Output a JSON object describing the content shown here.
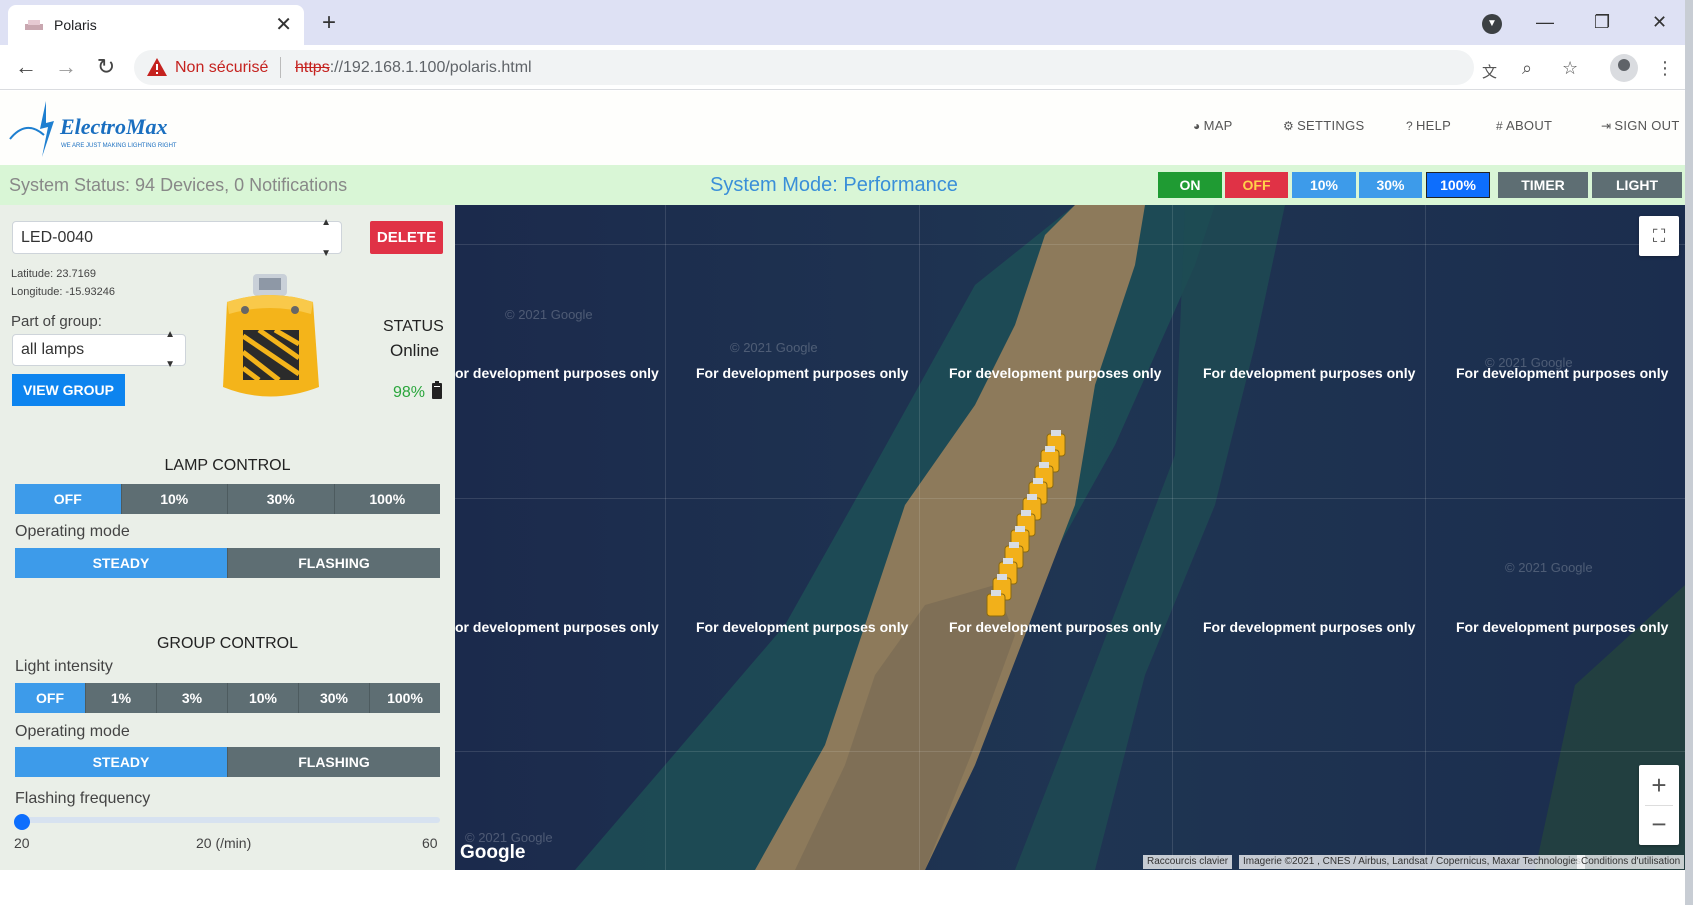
{
  "browser": {
    "tab_title": "Polaris",
    "not_secure": "Non sécurisé",
    "url_scheme": "https",
    "url_rest": "://192.168.1.100/polaris.html"
  },
  "header": {
    "logo_text": "ElectroMax",
    "logo_tagline": "WE ARE JUST MAKING LIGHTING RIGHT",
    "nav": {
      "map": "MAP",
      "settings": "SETTINGS",
      "help": "HELP",
      "about": "ABOUT",
      "sign_out": "SIGN OUT"
    }
  },
  "status_bar": {
    "system_status": "System Status: 94 Devices, 0 Notifications",
    "system_mode": "System Mode: Performance",
    "buttons": {
      "on": "ON",
      "off": "OFF",
      "p10": "10%",
      "p30": "30%",
      "p100": "100%",
      "timer": "TIMER",
      "light": "LIGHT"
    }
  },
  "panel": {
    "device_select": "LED-0040",
    "delete": "DELETE",
    "latitude": "Latitude: 23.7169",
    "longitude": "Longitude: -15.93246",
    "part_of_group": "Part of group:",
    "group_select": "all lamps",
    "view_group": "VIEW GROUP",
    "status_label": "STATUS",
    "status_value": "Online",
    "battery": "98%",
    "lamp_control": {
      "title": "LAMP CONTROL",
      "levels": [
        "OFF",
        "10%",
        "30%",
        "100%"
      ],
      "operating_mode_label": "Operating mode",
      "modes": [
        "STEADY",
        "FLASHING"
      ]
    },
    "group_control": {
      "title": "GROUP CONTROL",
      "light_intensity_label": "Light intensity",
      "levels": [
        "OFF",
        "1%",
        "3%",
        "10%",
        "30%",
        "100%"
      ],
      "operating_mode_label": "Operating mode",
      "modes": [
        "STEADY",
        "FLASHING"
      ],
      "flashing_frequency_label": "Flashing frequency",
      "slider_min": "20",
      "slider_value": "20 (/min)",
      "slider_max": "60",
      "slider_fraction": 0
    }
  },
  "map": {
    "dev_text": "For development purposes only",
    "dev_text_partial": "or development purposes only",
    "watermark": "© 2021 Google",
    "google": "Google",
    "attrib_shortcuts": "Raccourcis clavier",
    "attrib_imagery": "Imagerie ©2021 , CNES / Airbus, Landsat / Copernicus, Maxar Technologies",
    "attrib_terms": "Conditions d'utilisation"
  },
  "colors": {
    "on": "#1f9b33",
    "off": "#e03246",
    "off_text": "#ffd24a",
    "pct": "#3d9bea",
    "pct_active": "#0d6efd",
    "dark_btn": "#5e6e73"
  }
}
